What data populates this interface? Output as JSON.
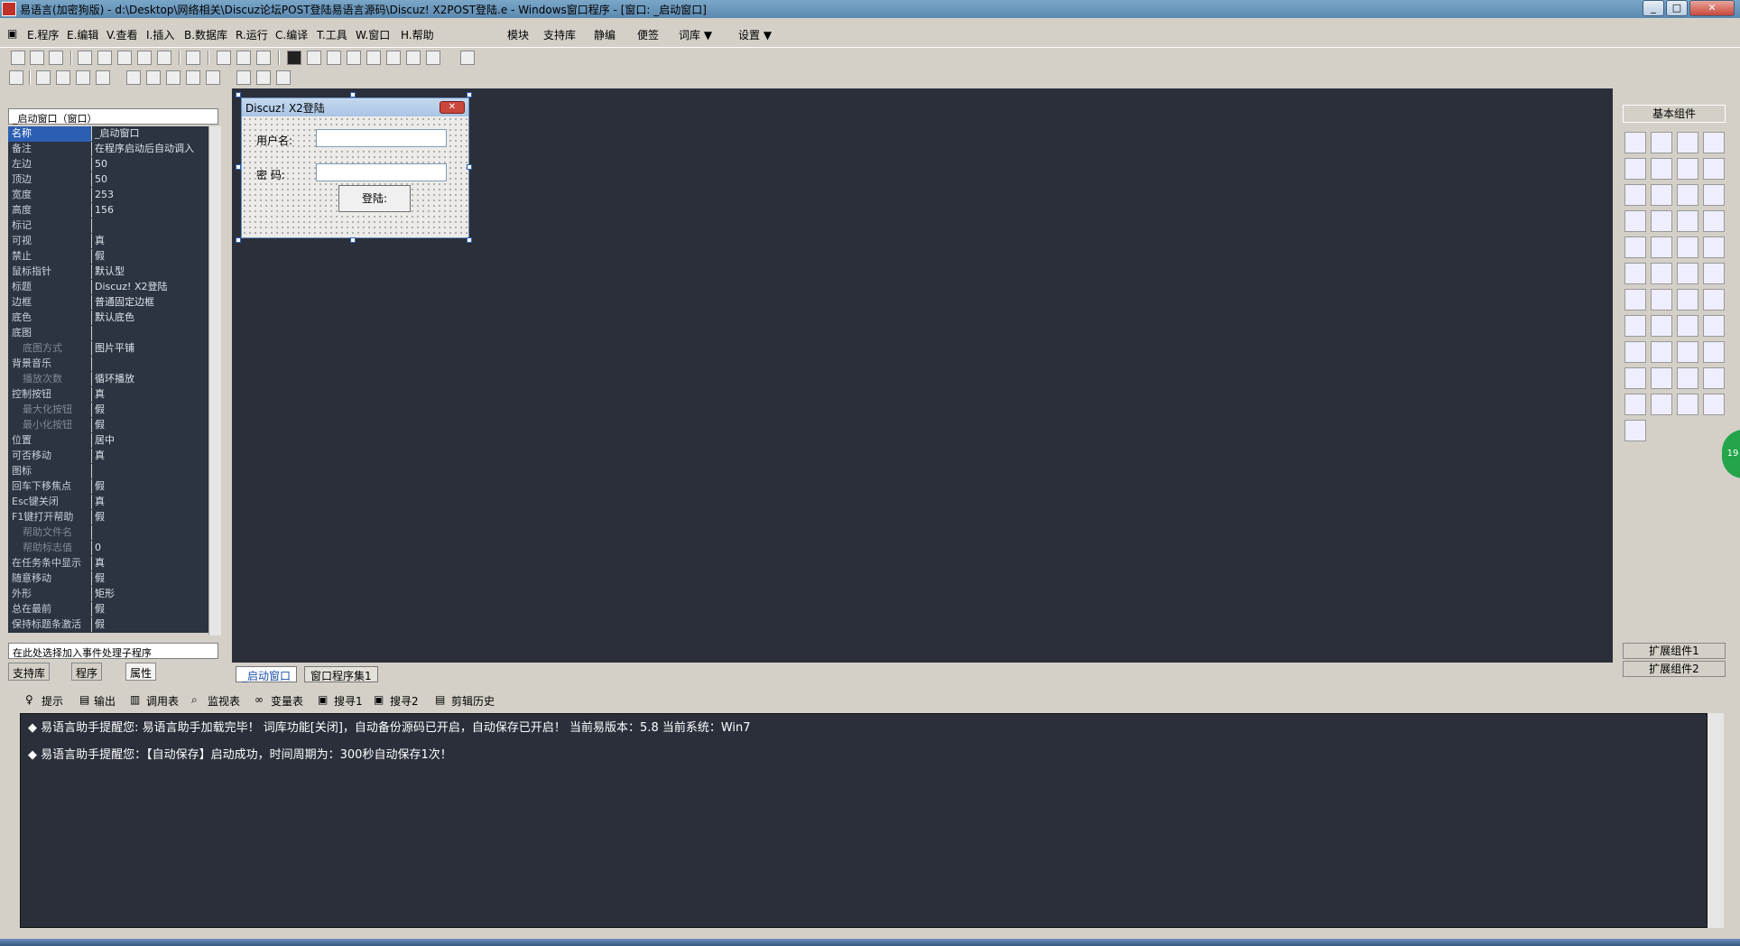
{
  "window": {
    "title": "易语言(加密狗版) - d:\\Desktop\\网络相关\\Discuz论坛POST登陆易语言源码\\Discuz! X2POST登陆.e - Windows窗口程序 - [窗口: _启动窗口]"
  },
  "menu": [
    "E.程序",
    "E.编辑",
    "V.查看",
    "I.插入",
    "B.数据库",
    "R.运行",
    "C.编译",
    "T.工具",
    "W.窗口",
    "H.帮助",
    "模块",
    "支持库",
    "静编",
    "便签",
    "词库 ▼",
    "设置 ▼"
  ],
  "combo": "_启动窗口（窗口）",
  "props": [
    {
      "n": "名称",
      "v": "_启动窗口"
    },
    {
      "n": "备注",
      "v": "在程序启动后自动调入"
    },
    {
      "n": "左边",
      "v": "50"
    },
    {
      "n": "顶边",
      "v": "50"
    },
    {
      "n": "宽度",
      "v": "253"
    },
    {
      "n": "高度",
      "v": "156"
    },
    {
      "n": "标记",
      "v": ""
    },
    {
      "n": "可视",
      "v": "真"
    },
    {
      "n": "禁止",
      "v": "假"
    },
    {
      "n": "鼠标指针",
      "v": "默认型"
    },
    {
      "n": "标题",
      "v": "Discuz! X2登陆"
    },
    {
      "n": "边框",
      "v": "普通固定边框"
    },
    {
      "n": "底色",
      "v": "默认底色"
    },
    {
      "n": "底图",
      "v": ""
    },
    {
      "n": "底图方式",
      "v": "图片平铺"
    },
    {
      "n": "背景音乐",
      "v": ""
    },
    {
      "n": "播放次数",
      "v": "循环播放"
    },
    {
      "n": "控制按钮",
      "v": "真"
    },
    {
      "n": "最大化按钮",
      "v": "假"
    },
    {
      "n": "最小化按钮",
      "v": "假"
    },
    {
      "n": "位置",
      "v": "居中"
    },
    {
      "n": "可否移动",
      "v": "真"
    },
    {
      "n": "图标",
      "v": ""
    },
    {
      "n": "回车下移焦点",
      "v": "假"
    },
    {
      "n": "Esc键关闭",
      "v": "真"
    },
    {
      "n": "F1键打开帮助",
      "v": "假"
    },
    {
      "n": "帮助文件名",
      "v": ""
    },
    {
      "n": "帮助标志值",
      "v": "0"
    },
    {
      "n": "在任务条中显示",
      "v": "真"
    },
    {
      "n": "随意移动",
      "v": "假"
    },
    {
      "n": "外形",
      "v": "矩形"
    },
    {
      "n": "总在最前",
      "v": "假"
    },
    {
      "n": "保持标题条激活",
      "v": "假"
    }
  ],
  "event_combo": "在此处选择加入事件处理子程序",
  "left_tabs": [
    "支持库",
    "程序",
    "属性"
  ],
  "form": {
    "title": "Discuz! X2登陆",
    "user_label": "用户名:",
    "pass_label": "密  码:",
    "login": "登陆:"
  },
  "right": {
    "head": "基本组件",
    "ext1": "扩展组件1",
    "ext2": "扩展组件2"
  },
  "doc_tabs": [
    "_启动窗口",
    "窗口程序集1"
  ],
  "bottom_tabs": [
    "提示",
    "输出",
    "调用表",
    "监视表",
    "变量表",
    "搜寻1",
    "搜寻2",
    "剪辑历史"
  ],
  "output": [
    "◆ 易语言助手提醒您:  易语言助手加载完毕！ 词库功能[关闭]，自动备份源码已开启，自动保存已开启！ 当前易版本：5.8  当前系统：Win7",
    "◆ 易语言助手提醒您：【自动保存】启动成功，时间周期为：300秒自动保存1次！"
  ],
  "badge": "19"
}
